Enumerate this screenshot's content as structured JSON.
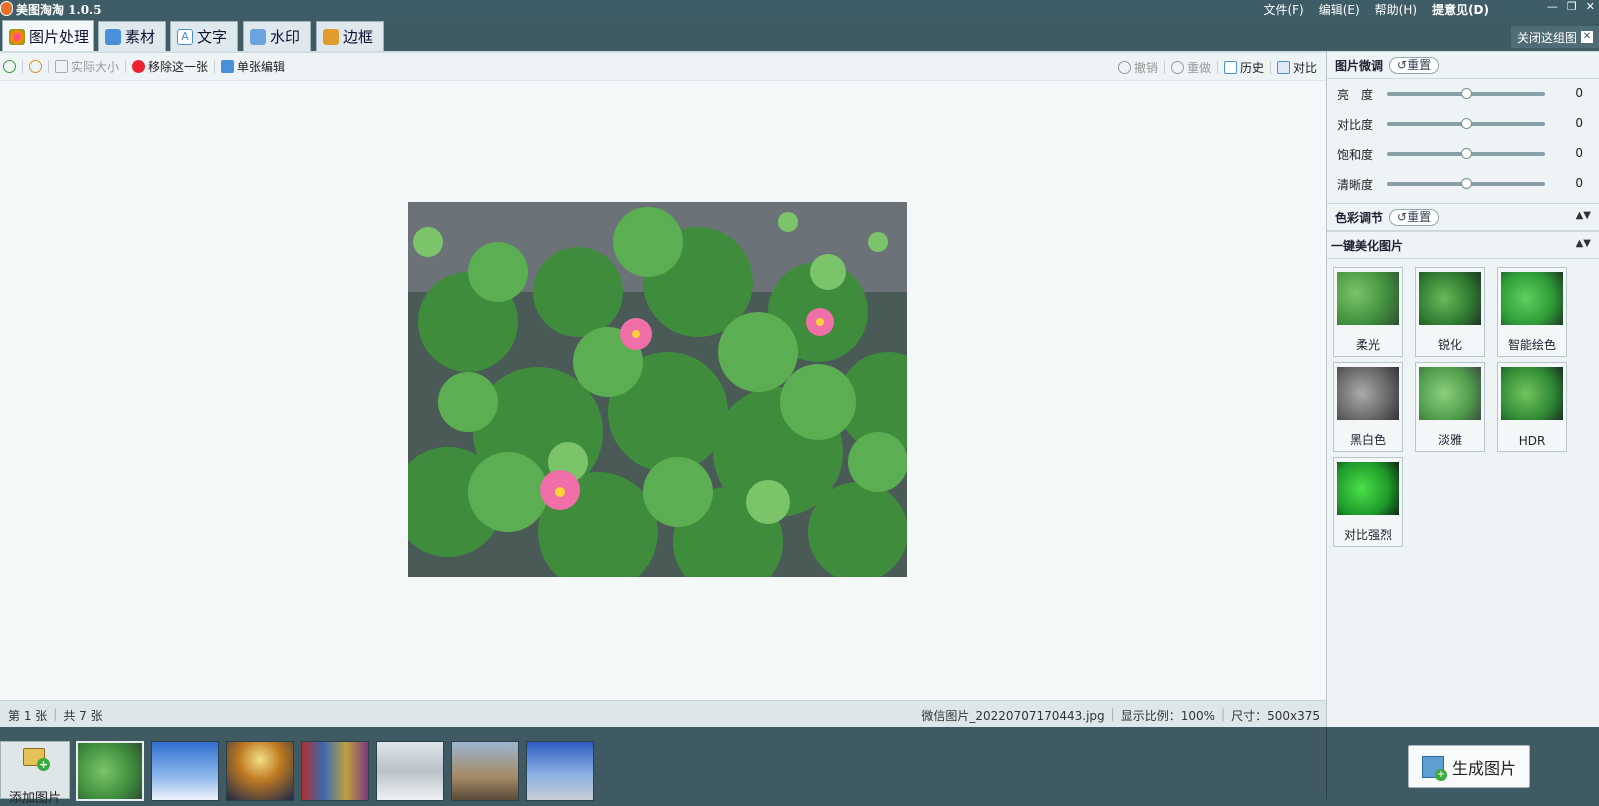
{
  "app": {
    "title": "美图淘淘 1.0.5"
  },
  "menu": [
    "文件(F)",
    "编辑(E)",
    "帮助(H)",
    "提意见(D)"
  ],
  "window_controls": [
    "—",
    "❐",
    "✕"
  ],
  "tabs": [
    {
      "label": "图片处理",
      "icon": "palette-icon",
      "color": "#d9574a",
      "active": true
    },
    {
      "label": "素材",
      "icon": "material-icon",
      "color": "#4a8fd9"
    },
    {
      "label": "文字",
      "icon": "text-icon",
      "color": "#4a8fd9"
    },
    {
      "label": "水印",
      "icon": "watermark-icon",
      "color": "#4a8fd9"
    },
    {
      "label": "边框",
      "icon": "border-icon",
      "color": "#e29b2e"
    }
  ],
  "close_group": {
    "label": "关闭这组图"
  },
  "toolbar": {
    "actual_size": "实际大小",
    "remove": "移除这一张",
    "single_edit": "单张编辑",
    "undo": "撤销",
    "redo": "重做",
    "history": "历史",
    "compare": "对比"
  },
  "status": {
    "current": "第 1 张",
    "total": "共 7 张",
    "filename": "微信图片_20220707170443.jpg",
    "zoom": "显示比例：100%",
    "size": "尺寸：500x375"
  },
  "panel": {
    "fine_tune": {
      "title": "图片微调",
      "reset": "重置",
      "sliders": [
        {
          "label": "亮　度",
          "value": 0,
          "fraction": 0.5
        },
        {
          "label": "对比度",
          "value": 0,
          "fraction": 0.5
        },
        {
          "label": "饱和度",
          "value": 0,
          "fraction": 0.5
        },
        {
          "label": "清晰度",
          "value": 0,
          "fraction": 0.5
        }
      ]
    },
    "color": {
      "title": "色彩调节",
      "reset": "重置"
    },
    "beautify": {
      "title": "一键美化图片",
      "effects": [
        "柔光",
        "锐化",
        "智能绘色",
        "黑白色",
        "淡雅",
        "HDR",
        "对比强烈"
      ]
    }
  },
  "bottom": {
    "add_label": "添加图片",
    "generate_label": "生成图片"
  },
  "colors": {
    "accent": "#3f5d66",
    "panel_bg": "#eef3f5"
  }
}
